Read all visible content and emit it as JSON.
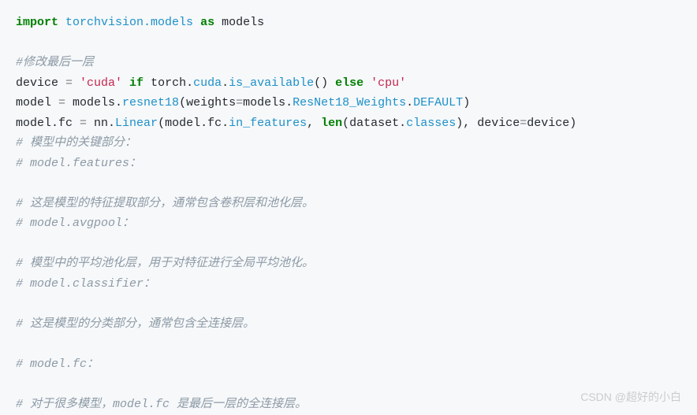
{
  "lines": {
    "l1": {
      "import": "import",
      "module": "torchvision.models",
      "as": "as",
      "alias": "models"
    },
    "l2": {
      "comment": "#修改最后一层"
    },
    "l3": {
      "device": "device",
      "eq": " = ",
      "cuda": "'cuda'",
      "if": " if ",
      "torch": "torch.",
      "cudans": "cuda",
      "dot": ".",
      "isavail": "is_available",
      "paren": "()",
      "else": " else ",
      "cpu": "'cpu'"
    },
    "l4": {
      "model": "model",
      "eq": " = ",
      "models": "models.",
      "resnet": "resnet18",
      "open": "(",
      "weights": "weights",
      "assign": "=",
      "models2": "models.",
      "cls": "ResNet18_Weights",
      "dot": ".",
      "default": "DEFAULT",
      "close": ")"
    },
    "l5": {
      "modelfc": "model.fc",
      "eq": " = ",
      "nn": "nn.",
      "linear": "Linear",
      "open": "(",
      "modelfc2": "model.fc.",
      "infeat": "in_features",
      "comma1": ", ",
      "len": "len",
      "open2": "(",
      "dataset": "dataset.",
      "classes": "classes",
      "close2": ")",
      "comma2": ", ",
      "devicep": "device",
      "assign": "=",
      "devicev": "device",
      "close": ")"
    },
    "c1": "# 模型中的关键部分：",
    "c2": "# model.features：",
    "c3": "# 这是模型的特征提取部分，通常包含卷积层和池化层。",
    "c4": "# model.avgpool：",
    "c5": "# 模型中的平均池化层，用于对特征进行全局平均池化。",
    "c6": "# model.classifier：",
    "c7": "# 这是模型的分类部分，通常包含全连接层。",
    "c8": "# model.fc：",
    "c9": "# 对于很多模型，model.fc 是最后一层的全连接层。"
  },
  "watermark": "CSDN @超好的小白"
}
